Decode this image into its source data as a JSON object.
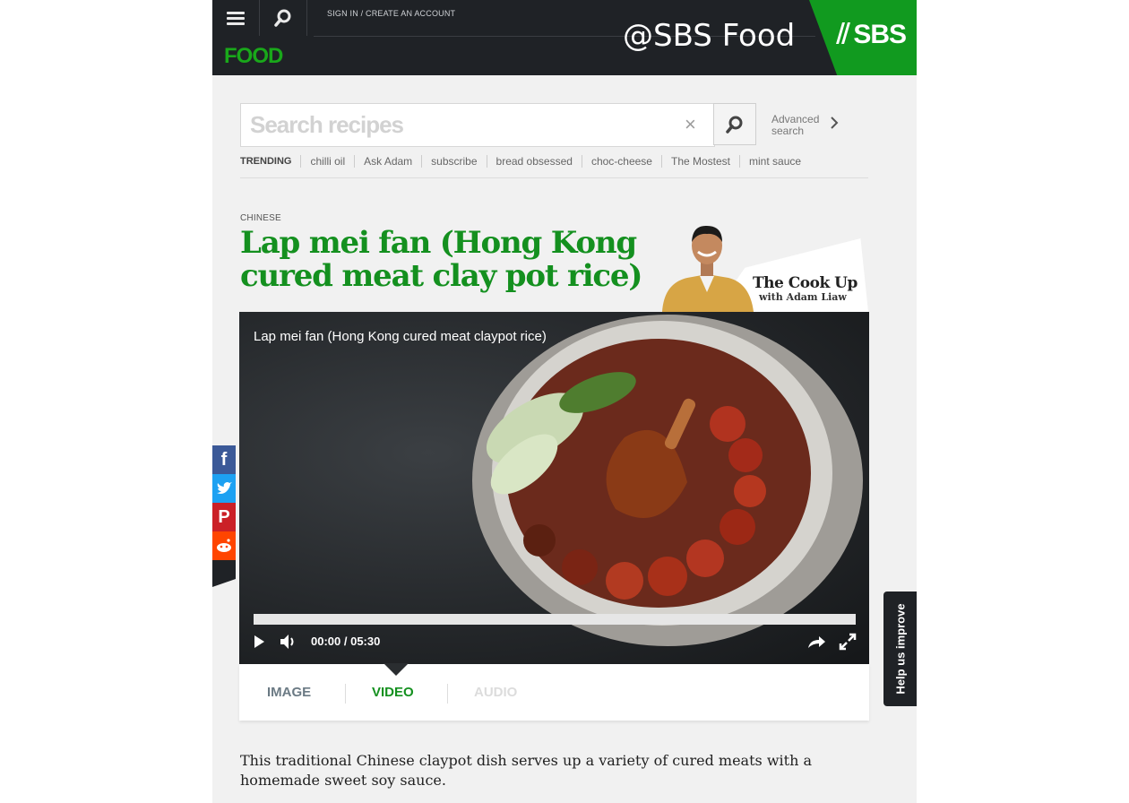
{
  "header": {
    "signin": "SIGN IN / CREATE AN ACCOUNT",
    "logo": "FOOD",
    "watermark": "@SBS Food",
    "brand": "SBS",
    "icons": {
      "menu": "hamburger-menu-icon",
      "search": "search-icon"
    }
  },
  "search": {
    "placeholder": "Search recipes",
    "clear": "×",
    "advanced": [
      "Advanced",
      "search"
    ]
  },
  "trending": {
    "label": "TRENDING",
    "items": [
      "chilli oil",
      "Ask Adam",
      "subscribe",
      "bread obsessed",
      "choc-cheese",
      "The Mostest",
      "mint sauce"
    ]
  },
  "recipe": {
    "category": "CHINESE",
    "title": "Lap mei fan (Hong Kong cured meat clay pot rice)",
    "description": "This traditional Chinese claypot dish serves up a variety of cured meats with a homemade sweet soy sauce."
  },
  "promo": {
    "title": "The Cook Up",
    "subtitle": "with Adam Liaw"
  },
  "video": {
    "title": "Lap mei fan (Hong Kong cured meat claypot rice)",
    "time": "00:00 / 05:30",
    "progress": 0
  },
  "tabs": [
    "IMAGE",
    "VIDEO",
    "AUDIO"
  ],
  "active_tab": "VIDEO",
  "social": [
    "facebook",
    "twitter",
    "pinterest",
    "reddit"
  ],
  "help": "Help us improve",
  "colors": {
    "green": "#14901f",
    "header": "#1f2226",
    "sbs_green": "#119a1f"
  }
}
